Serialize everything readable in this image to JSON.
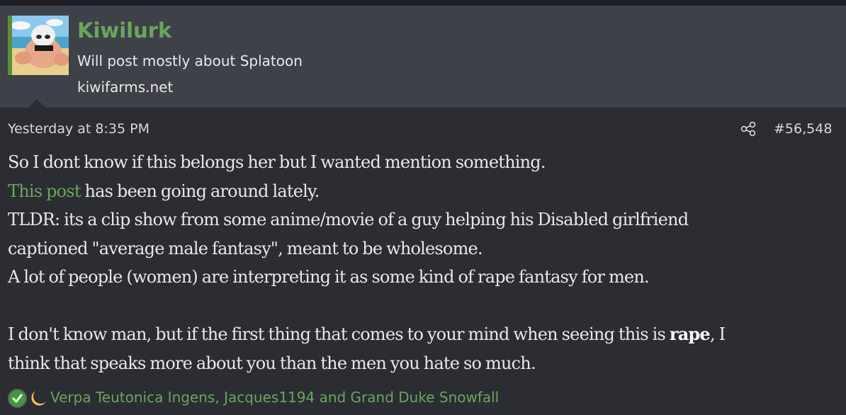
{
  "user": {
    "name": "Kiwilurk",
    "title": "Will post mostly about Splatoon",
    "website": "kiwifarms.net"
  },
  "post": {
    "date": "Yesterday at 8:35 PM",
    "number": "#56,548",
    "line1": "So I dont know if this belongs her but I wanted mention something.",
    "line2_link": "This post",
    "line2_rest": " has been going around lately.",
    "line3": "TLDR: its a clip show from some anime/movie of a guy helping his Disabled girlfriend",
    "line4": "captioned \"average male fantasy\", meant to be wholesome.",
    "line5": "A lot of people (women) are interpreting it as some kind of rape fantasy for men.",
    "line6_pre": "I don't know man, but if the first thing that comes to your mind when seeing this is ",
    "line6_bold": "rape",
    "line6_post": ", I",
    "line7": "think that speaks more about you than the men you hate so much."
  },
  "reactions": {
    "icons": [
      "agree-check-icon",
      "lunacy-moon-icon"
    ],
    "users": "Verpa Teutonica Ingens, Jacques1194 and Grand Duke Snowfall"
  },
  "colors": {
    "background": "#2b2d33",
    "header_background": "#3f4148",
    "accent_green": "#6aa55d",
    "text": "#e8e8e8"
  }
}
